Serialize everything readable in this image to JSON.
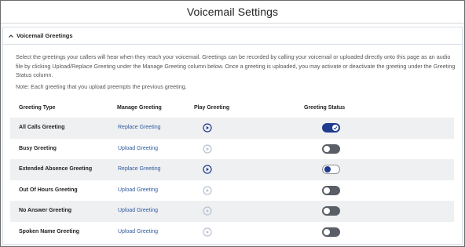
{
  "page": {
    "title": "Voicemail Settings"
  },
  "section": {
    "title": "Voicemail Greetings",
    "description": "Select the greetings your callers will hear when they reach your voicemail. Greetings can be recorded by calling your voicemail or uploaded directly onto this page as an audio file by clicking Upload/Replace Greeting under the Manage Greeting column below. Once a greeting is uploaded, you may activate or deactivate the greeting under the Greeting Status column.",
    "note": "Note: Each greeting that you upload preempts the previous greeting."
  },
  "table": {
    "headers": {
      "type": "Greeting Type",
      "manage": "Manage Greeting",
      "play": "Play Greeting",
      "status": "Greeting Status"
    },
    "rows": [
      {
        "type": "All Calls Greeting",
        "action": "Replace Greeting",
        "playable": true,
        "status": "on"
      },
      {
        "type": "Busy Greeting",
        "action": "Upload Greeting",
        "playable": false,
        "status": "off"
      },
      {
        "type": "Extended Absence Greeting",
        "action": "Replace Greeting",
        "playable": true,
        "status": "on-light"
      },
      {
        "type": "Out Of Hours Greeting",
        "action": "Upload Greeting",
        "playable": false,
        "status": "off"
      },
      {
        "type": "No Answer Greeting",
        "action": "Upload Greeting",
        "playable": false,
        "status": "off"
      },
      {
        "type": "Spoken Name Greeting",
        "action": "Upload Greeting",
        "playable": false,
        "status": "off"
      }
    ]
  },
  "colors": {
    "accent": "#1f3b8f",
    "link": "#2e5a9e",
    "disabled": "#b9c2d4",
    "toggle_off": "#5a5e66",
    "row_alt": "#eff0f2"
  },
  "icons": {
    "collapse": "chevron-up-icon",
    "play": "play-circle-icon",
    "check": "check-icon"
  }
}
